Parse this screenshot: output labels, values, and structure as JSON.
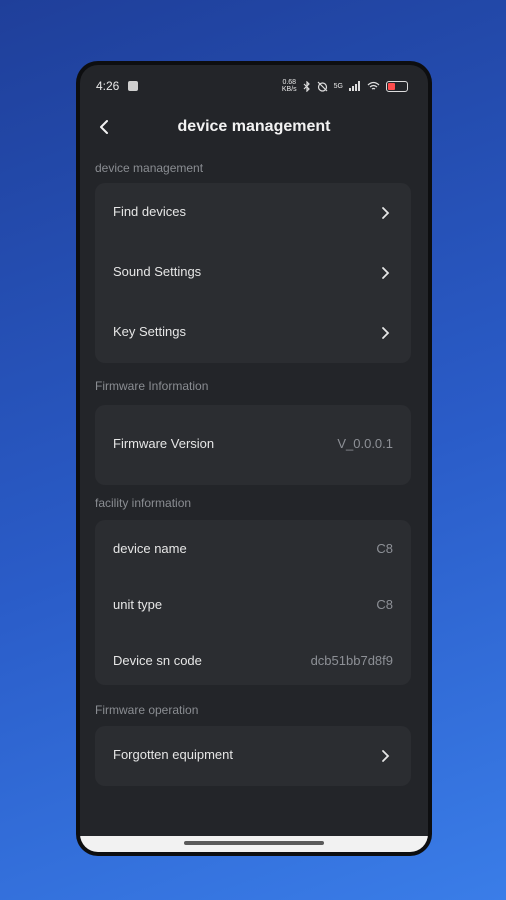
{
  "status_bar": {
    "time": "4:26",
    "network_speed": "0.68\nKB/s",
    "signal": "5G",
    "battery": "37",
    "battery_level": 0.37
  },
  "header": {
    "title": "device management"
  },
  "sections": {
    "device_management": {
      "label": "device management",
      "items": [
        "Find devices",
        "Sound Settings",
        "Key Settings"
      ]
    },
    "firmware_information": {
      "label": "Firmware Information",
      "firmware_version_label": "Firmware Version",
      "firmware_version_value": "V_0.0.0.1"
    },
    "facility_information": {
      "label": "facility information",
      "rows": [
        {
          "label": "device name",
          "value": "C8"
        },
        {
          "label": "unit type",
          "value": "C8"
        },
        {
          "label": "Device sn code",
          "value": "dcb51bb7d8f9"
        }
      ]
    },
    "firmware_operation": {
      "label": "Firmware operation",
      "item": "Forgotten equipment"
    }
  },
  "colors": {
    "background": "#232529",
    "card": "#2b2d31",
    "accent": "#2a5cc8"
  }
}
